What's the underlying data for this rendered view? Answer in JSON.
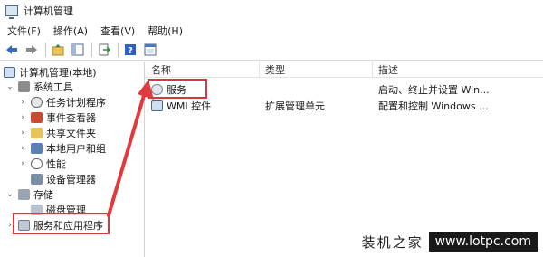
{
  "window": {
    "title": "计算机管理"
  },
  "menu": [
    "文件(F)",
    "操作(A)",
    "查看(V)",
    "帮助(H)"
  ],
  "toolbar": [
    "back-icon",
    "forward-icon",
    "up-folder-icon",
    "show-hide-tree-icon",
    "export-list-icon",
    "help-icon",
    "properties-icon"
  ],
  "tree": {
    "root": "计算机管理(本地)",
    "system_tools": "系统工具",
    "items": [
      "任务计划程序",
      "事件查看器",
      "共享文件夹",
      "本地用户和组",
      "性能",
      "设备管理器"
    ],
    "storage": "存储",
    "disk": "磁盘管理",
    "services_apps": "服务和应用程序"
  },
  "columns": {
    "name": "名称",
    "type": "类型",
    "desc": "描述"
  },
  "rows": [
    {
      "name": "服务",
      "type": "",
      "desc": "启动、终止并设置 Win..."
    },
    {
      "name": "WMI 控件",
      "type": "扩展管理单元",
      "desc": "配置和控制 Windows ..."
    }
  ],
  "watermark": {
    "cn": "装机之家",
    "url": "www.lotpc.com"
  },
  "colors": {
    "highlight": "#d9363e",
    "arrow": "#e0393e"
  }
}
